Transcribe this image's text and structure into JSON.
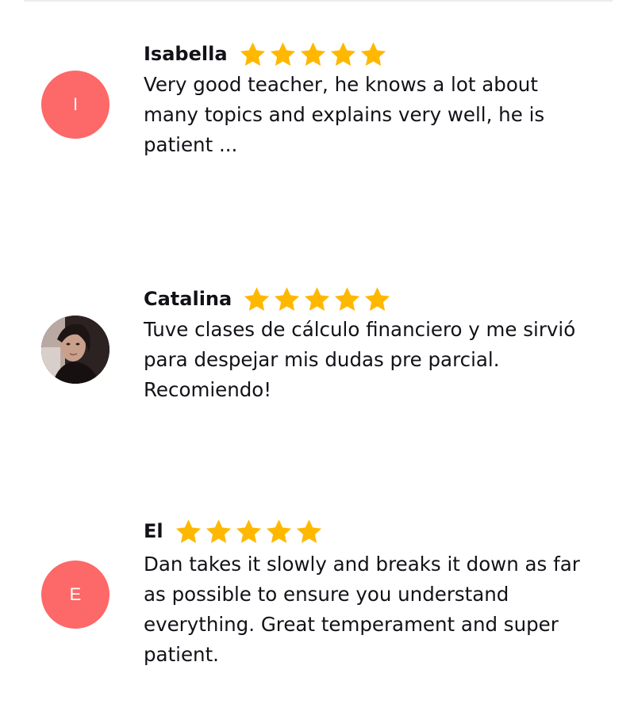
{
  "colors": {
    "star": "#FFB800",
    "avatar_background": "#FD6868",
    "text": "#121117"
  },
  "reviews": [
    {
      "name": "Isabella",
      "avatar_initial": "I",
      "avatar_type": "initial",
      "rating": 5,
      "text": "Very good teacher, he knows a lot about many topics and explains very well, he is patient ..."
    },
    {
      "name": "Catalina",
      "avatar_initial": "",
      "avatar_type": "photo",
      "rating": 5,
      "text": "Tuve clases de cálculo financiero y me sirvió para despejar mis dudas pre parcial. Recomiendo!"
    },
    {
      "name": "El",
      "avatar_initial": "E",
      "avatar_type": "initial",
      "rating": 5,
      "text": "Dan takes it slowly and breaks it down as far as possible to ensure you understand everything. Great temperament and super patient."
    }
  ]
}
